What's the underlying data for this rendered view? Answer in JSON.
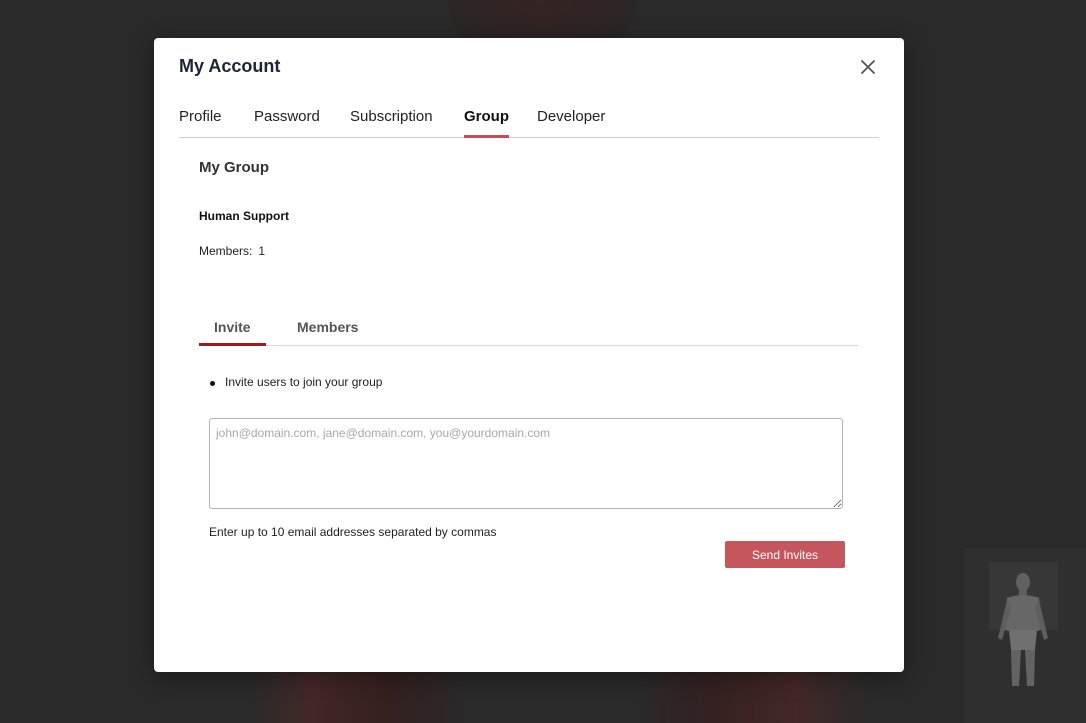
{
  "modal": {
    "title": "My Account",
    "close_icon": "close-icon"
  },
  "tabs": [
    {
      "label": "Profile",
      "active": false
    },
    {
      "label": "Password",
      "active": false
    },
    {
      "label": "Subscription",
      "active": false
    },
    {
      "label": "Group",
      "active": true
    },
    {
      "label": "Developer",
      "active": false
    }
  ],
  "group": {
    "section_title": "My Group",
    "name": "Human Support",
    "members_label": "Members:",
    "members_count": "1"
  },
  "subtabs": [
    {
      "label": "Invite",
      "active": true
    },
    {
      "label": "Members",
      "active": false
    }
  ],
  "invite": {
    "bullet": "Invite users to join your group",
    "emails_value": "",
    "emails_placeholder": "john@domain.com, jane@domain.com, you@yourdomain.com",
    "helper": "Enter up to 10 email addresses separated by commas",
    "send_label": "Send Invites"
  },
  "colors": {
    "accent": "#c94b52",
    "send_button": "#c5565d",
    "subtab_active": "#9c1c1c",
    "backdrop": "#2e2e2e"
  }
}
